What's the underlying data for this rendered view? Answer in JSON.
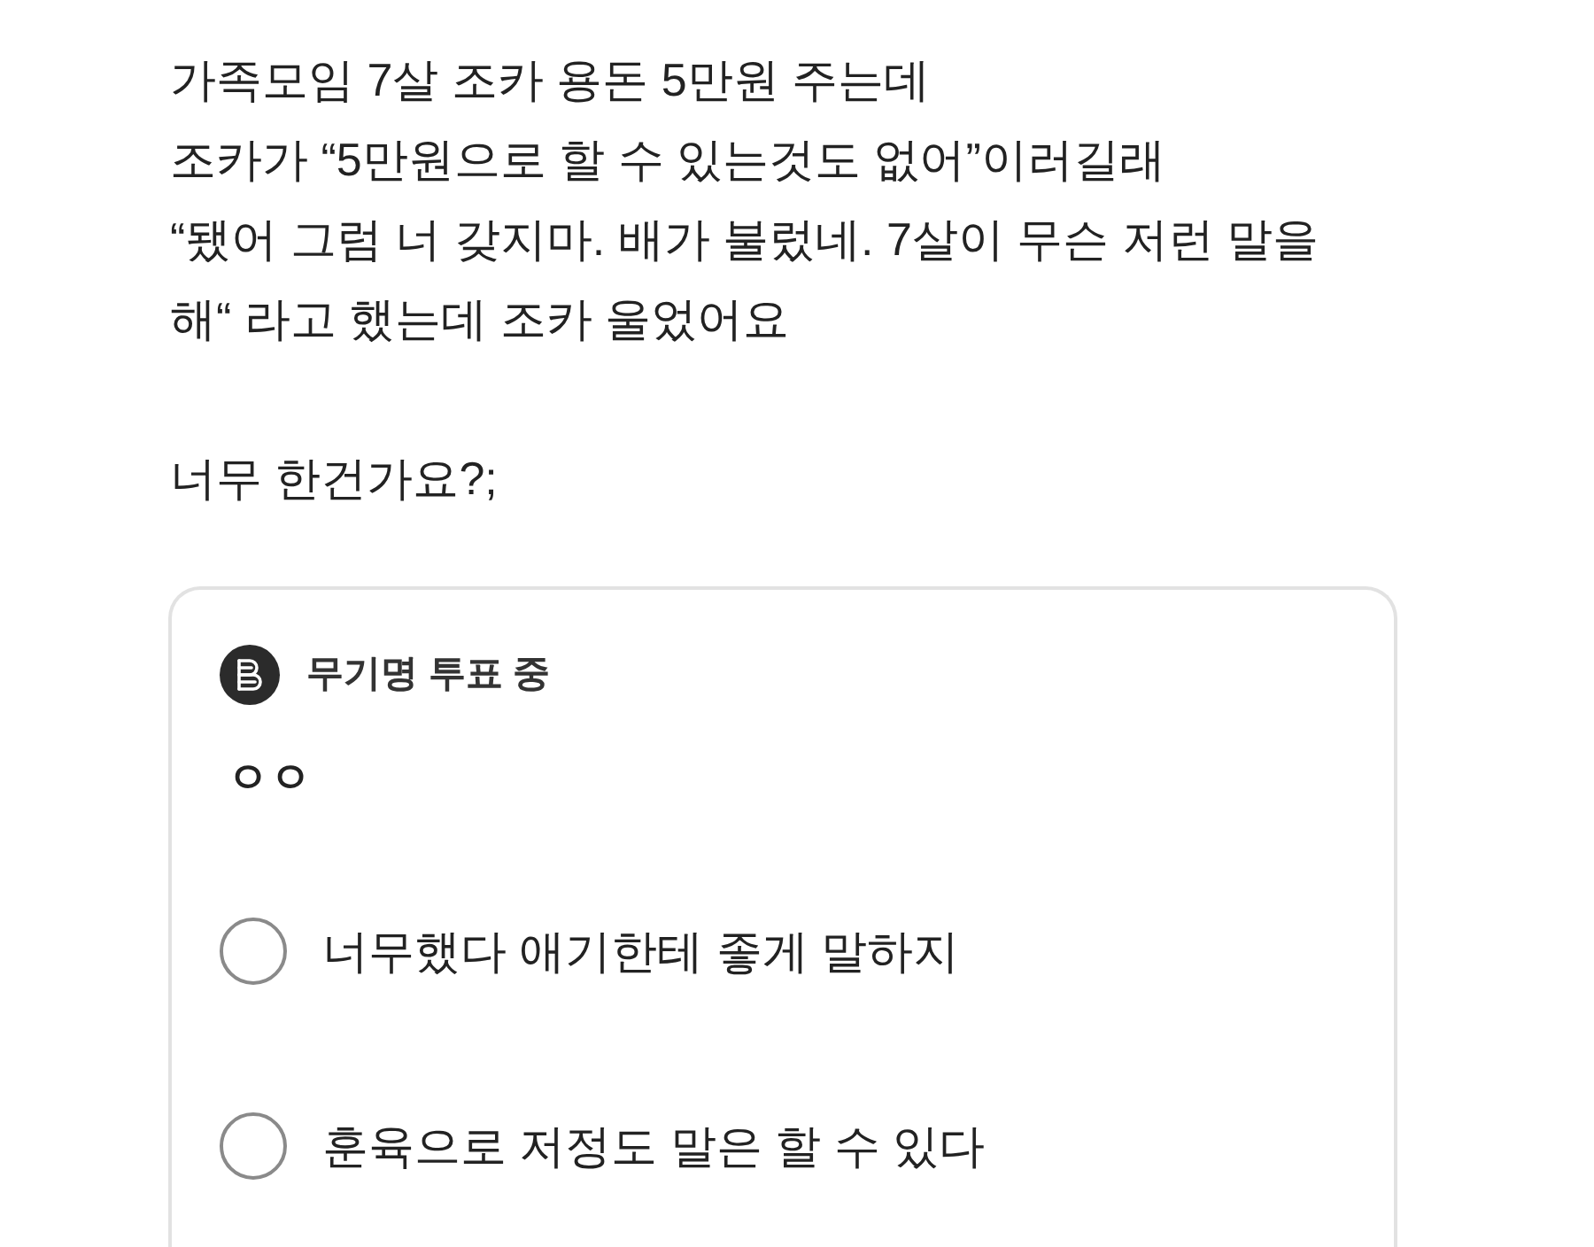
{
  "post": {
    "lines": [
      "가족모임 7살 조카 용돈 5만원 주는데",
      "조카가 “5만원으로 할 수 있는것도 없어”이러길래",
      "“됐어 그럼 너 갖지마. 배가 불렀네. 7살이 무슨 저런 말을",
      "해“ 라고 했는데 조카 울었어요"
    ],
    "question": "너무 한건가요?;"
  },
  "poll": {
    "status": "무기명 투표 중",
    "title": "ㅇㅇ",
    "options": [
      {
        "label": "너무했다 애기한테 좋게 말하지",
        "selected": false
      },
      {
        "label": "훈육으로 저정도 말은 할 수 있다",
        "selected": false
      }
    ]
  }
}
